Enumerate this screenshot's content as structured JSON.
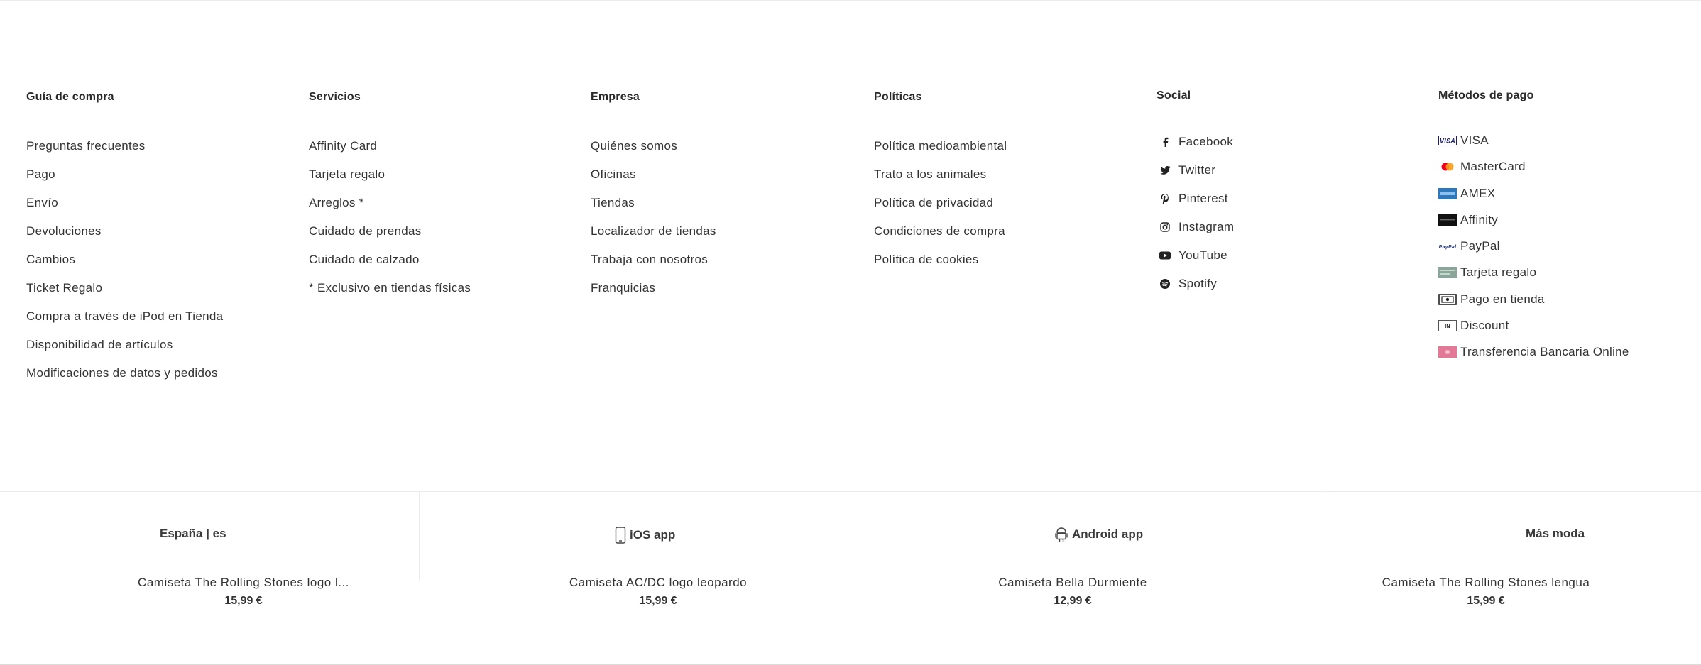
{
  "columns": {
    "guia": {
      "title": "Guía de compra",
      "links": [
        "Preguntas frecuentes",
        "Pago",
        "Envío",
        "Devoluciones",
        "Cambios",
        "Ticket Regalo",
        "Compra a través de iPod en Tienda",
        "Disponibilidad de artículos",
        "Modificaciones de datos y pedidos"
      ]
    },
    "servicios": {
      "title": "Servicios",
      "links": [
        "Affinity Card",
        "Tarjeta regalo",
        "Arreglos *",
        "Cuidado de prendas",
        "Cuidado de calzado"
      ],
      "note": "* Exclusivo en tiendas físicas"
    },
    "empresa": {
      "title": "Empresa",
      "links": [
        "Quiénes somos",
        "Oficinas",
        "Tiendas",
        "Localizador de tiendas",
        "Trabaja con nosotros",
        "Franquicias"
      ]
    },
    "politicas": {
      "title": "Políticas",
      "links": [
        "Política medioambiental",
        "Trato a los animales",
        "Política de privacidad",
        "Condiciones de compra",
        "Política de cookies"
      ]
    },
    "social": {
      "title": "Social",
      "items": [
        {
          "label": "Facebook",
          "icon": "facebook-icon"
        },
        {
          "label": "Twitter",
          "icon": "twitter-icon"
        },
        {
          "label": "Pinterest",
          "icon": "pinterest-icon"
        },
        {
          "label": "Instagram",
          "icon": "instagram-icon"
        },
        {
          "label": "YouTube",
          "icon": "youtube-icon"
        },
        {
          "label": "Spotify",
          "icon": "spotify-icon"
        }
      ]
    },
    "pago": {
      "title": "Métodos de pago",
      "items": [
        {
          "label": "VISA",
          "icon": "visa-icon"
        },
        {
          "label": "MasterCard",
          "icon": "mastercard-icon"
        },
        {
          "label": "AMEX",
          "icon": "amex-icon"
        },
        {
          "label": "Affinity",
          "icon": "affinity-card-icon"
        },
        {
          "label": "PayPal",
          "icon": "paypal-icon"
        },
        {
          "label": "Tarjeta regalo",
          "icon": "gift-card-icon"
        },
        {
          "label": "Pago en tienda",
          "icon": "store-payment-icon"
        },
        {
          "label": "Discount",
          "icon": "discount-icon"
        },
        {
          "label": "Transferencia Bancaria Online",
          "icon": "bank-transfer-icon"
        }
      ]
    }
  },
  "bottom": {
    "locale": "España | es",
    "ios": "iOS app",
    "android": "Android app",
    "more": "Más moda",
    "products": [
      {
        "name": "Camiseta The Rolling Stones logo l...",
        "price": "15,99 €"
      },
      {
        "name": "Camiseta AC/DC logo leopardo",
        "price": "15,99 €"
      },
      {
        "name": "Camiseta Bella Durmiente",
        "price": "12,99 €"
      },
      {
        "name": "Camiseta The Rolling Stones lengua",
        "price": "15,99 €"
      }
    ]
  },
  "colors": {
    "text": "#333333",
    "separator": "#ebebeb",
    "mastercard_red": "#eb001b",
    "mastercard_orange": "#f79e1b",
    "visa_blue": "#1a1f71",
    "amex_blue": "#2e77bb",
    "transfer_pink": "#e27a97"
  }
}
